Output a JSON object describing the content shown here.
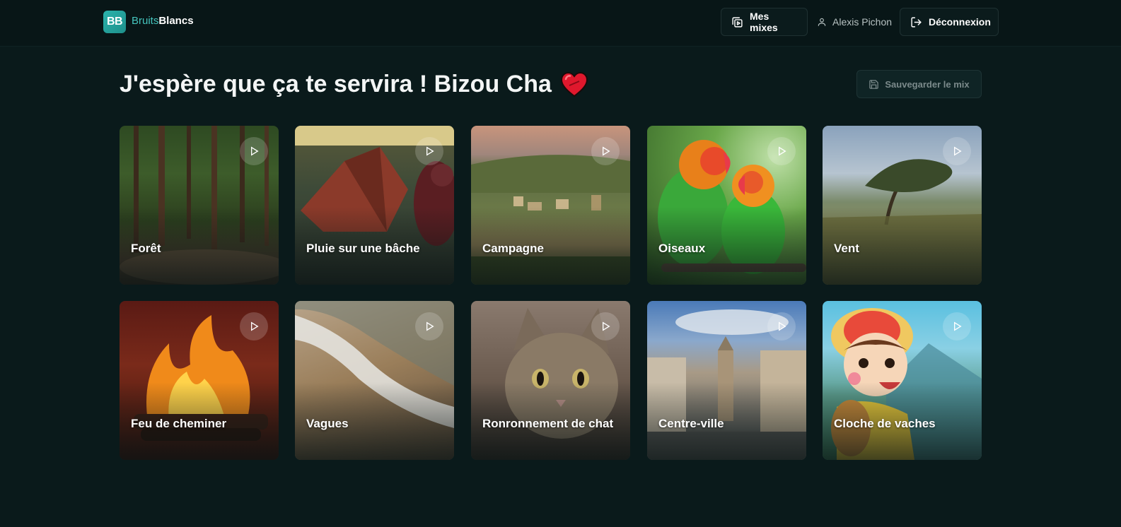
{
  "brand": {
    "logo_text": "BB",
    "name_part1": "Bruits",
    "name_part2": "Blancs"
  },
  "nav": {
    "mixes_label": "Mes mixes",
    "user_name": "Alexis Pichon",
    "logout_label": "Déconnexion"
  },
  "page": {
    "title": "J'espère que ça te servira ! Bizou Cha",
    "save_label": "Sauvegarder le mix"
  },
  "sounds": [
    {
      "label": "Forêt",
      "icon": "forest-image"
    },
    {
      "label": "Pluie sur une bâche",
      "icon": "rain-tarp-image"
    },
    {
      "label": "Campagne",
      "icon": "countryside-image"
    },
    {
      "label": "Oiseaux",
      "icon": "birds-image"
    },
    {
      "label": "Vent",
      "icon": "wind-image"
    },
    {
      "label": "Feu de cheminer",
      "icon": "fireplace-image"
    },
    {
      "label": "Vagues",
      "icon": "waves-image"
    },
    {
      "label": "Ronronnement de chat",
      "icon": "cat-image"
    },
    {
      "label": "Centre-ville",
      "icon": "city-image"
    },
    {
      "label": "Cloche de vaches",
      "icon": "cowbell-image"
    }
  ],
  "colors": {
    "background": "#0a1a1b",
    "topbar": "#081617",
    "accent": "#2bb3ac",
    "heart": "#e0182d"
  }
}
